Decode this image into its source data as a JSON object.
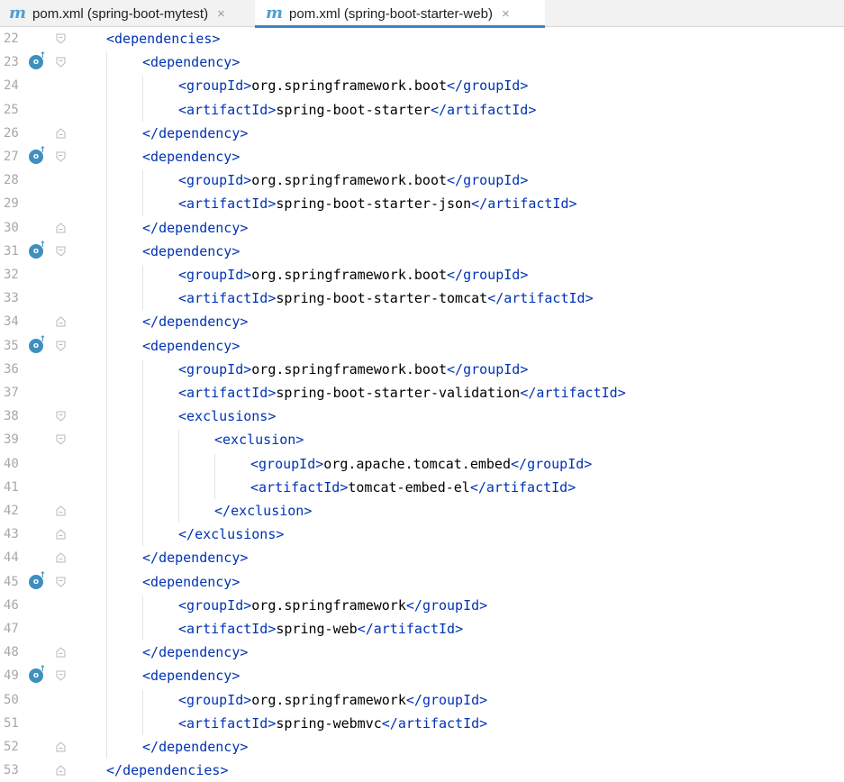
{
  "tabs": [
    {
      "icon": "m",
      "label": "pom.xml (spring-boot-mytest)",
      "close": "×",
      "active": false
    },
    {
      "icon": "m",
      "label": "pom.xml (spring-boot-starter-web)",
      "close": "×",
      "active": true
    }
  ],
  "colors": {
    "tag": "#0033b3",
    "text": "#000000",
    "line_number": "#a8a8a8",
    "accent": "#4083c9",
    "gutter_icon": "#3f8fbf"
  },
  "lines": [
    {
      "n": "22",
      "indent": 1,
      "open": "<",
      "tag": "dependencies",
      "close": ">",
      "text": "",
      "etag": "",
      "marker": "fold-open",
      "gicon": false
    },
    {
      "n": "23",
      "indent": 2,
      "open": "<",
      "tag": "dependency",
      "close": ">",
      "text": "",
      "etag": "",
      "marker": "fold-open",
      "gicon": true
    },
    {
      "n": "24",
      "indent": 3,
      "open": "<",
      "tag": "groupId",
      "close": ">",
      "text": "org.springframework.boot",
      "etag": "groupId",
      "marker": "",
      "gicon": false
    },
    {
      "n": "25",
      "indent": 3,
      "open": "<",
      "tag": "artifactId",
      "close": ">",
      "text": "spring-boot-starter",
      "etag": "artifactId",
      "marker": "",
      "gicon": false
    },
    {
      "n": "26",
      "indent": 2,
      "open": "</",
      "tag": "dependency",
      "close": ">",
      "text": "",
      "etag": "",
      "marker": "fold-close",
      "gicon": false
    },
    {
      "n": "27",
      "indent": 2,
      "open": "<",
      "tag": "dependency",
      "close": ">",
      "text": "",
      "etag": "",
      "marker": "fold-open",
      "gicon": true
    },
    {
      "n": "28",
      "indent": 3,
      "open": "<",
      "tag": "groupId",
      "close": ">",
      "text": "org.springframework.boot",
      "etag": "groupId",
      "marker": "",
      "gicon": false
    },
    {
      "n": "29",
      "indent": 3,
      "open": "<",
      "tag": "artifactId",
      "close": ">",
      "text": "spring-boot-starter-json",
      "etag": "artifactId",
      "marker": "",
      "gicon": false
    },
    {
      "n": "30",
      "indent": 2,
      "open": "</",
      "tag": "dependency",
      "close": ">",
      "text": "",
      "etag": "",
      "marker": "fold-close",
      "gicon": false
    },
    {
      "n": "31",
      "indent": 2,
      "open": "<",
      "tag": "dependency",
      "close": ">",
      "text": "",
      "etag": "",
      "marker": "fold-open",
      "gicon": true
    },
    {
      "n": "32",
      "indent": 3,
      "open": "<",
      "tag": "groupId",
      "close": ">",
      "text": "org.springframework.boot",
      "etag": "groupId",
      "marker": "",
      "gicon": false
    },
    {
      "n": "33",
      "indent": 3,
      "open": "<",
      "tag": "artifactId",
      "close": ">",
      "text": "spring-boot-starter-tomcat",
      "etag": "artifactId",
      "marker": "",
      "gicon": false
    },
    {
      "n": "34",
      "indent": 2,
      "open": "</",
      "tag": "dependency",
      "close": ">",
      "text": "",
      "etag": "",
      "marker": "fold-close",
      "gicon": false
    },
    {
      "n": "35",
      "indent": 2,
      "open": "<",
      "tag": "dependency",
      "close": ">",
      "text": "",
      "etag": "",
      "marker": "fold-open",
      "gicon": true
    },
    {
      "n": "36",
      "indent": 3,
      "open": "<",
      "tag": "groupId",
      "close": ">",
      "text": "org.springframework.boot",
      "etag": "groupId",
      "marker": "",
      "gicon": false
    },
    {
      "n": "37",
      "indent": 3,
      "open": "<",
      "tag": "artifactId",
      "close": ">",
      "text": "spring-boot-starter-validation",
      "etag": "artifactId",
      "marker": "",
      "gicon": false
    },
    {
      "n": "38",
      "indent": 3,
      "open": "<",
      "tag": "exclusions",
      "close": ">",
      "text": "",
      "etag": "",
      "marker": "fold-open",
      "gicon": false
    },
    {
      "n": "39",
      "indent": 4,
      "open": "<",
      "tag": "exclusion",
      "close": ">",
      "text": "",
      "etag": "",
      "marker": "fold-open",
      "gicon": false
    },
    {
      "n": "40",
      "indent": 5,
      "open": "<",
      "tag": "groupId",
      "close": ">",
      "text": "org.apache.tomcat.embed",
      "etag": "groupId",
      "marker": "",
      "gicon": false
    },
    {
      "n": "41",
      "indent": 5,
      "open": "<",
      "tag": "artifactId",
      "close": ">",
      "text": "tomcat-embed-el",
      "etag": "artifactId",
      "marker": "",
      "gicon": false
    },
    {
      "n": "42",
      "indent": 4,
      "open": "</",
      "tag": "exclusion",
      "close": ">",
      "text": "",
      "etag": "",
      "marker": "fold-close",
      "gicon": false
    },
    {
      "n": "43",
      "indent": 3,
      "open": "</",
      "tag": "exclusions",
      "close": ">",
      "text": "",
      "etag": "",
      "marker": "fold-close",
      "gicon": false
    },
    {
      "n": "44",
      "indent": 2,
      "open": "</",
      "tag": "dependency",
      "close": ">",
      "text": "",
      "etag": "",
      "marker": "fold-close",
      "gicon": false
    },
    {
      "n": "45",
      "indent": 2,
      "open": "<",
      "tag": "dependency",
      "close": ">",
      "text": "",
      "etag": "",
      "marker": "fold-open",
      "gicon": true
    },
    {
      "n": "46",
      "indent": 3,
      "open": "<",
      "tag": "groupId",
      "close": ">",
      "text": "org.springframework",
      "etag": "groupId",
      "marker": "",
      "gicon": false
    },
    {
      "n": "47",
      "indent": 3,
      "open": "<",
      "tag": "artifactId",
      "close": ">",
      "text": "spring-web",
      "etag": "artifactId",
      "marker": "",
      "gicon": false
    },
    {
      "n": "48",
      "indent": 2,
      "open": "</",
      "tag": "dependency",
      "close": ">",
      "text": "",
      "etag": "",
      "marker": "fold-close",
      "gicon": false
    },
    {
      "n": "49",
      "indent": 2,
      "open": "<",
      "tag": "dependency",
      "close": ">",
      "text": "",
      "etag": "",
      "marker": "fold-open",
      "gicon": true
    },
    {
      "n": "50",
      "indent": 3,
      "open": "<",
      "tag": "groupId",
      "close": ">",
      "text": "org.springframework",
      "etag": "groupId",
      "marker": "",
      "gicon": false
    },
    {
      "n": "51",
      "indent": 3,
      "open": "<",
      "tag": "artifactId",
      "close": ">",
      "text": "spring-webmvc",
      "etag": "artifactId",
      "marker": "",
      "gicon": false
    },
    {
      "n": "52",
      "indent": 2,
      "open": "</",
      "tag": "dependency",
      "close": ">",
      "text": "",
      "etag": "",
      "marker": "fold-close",
      "gicon": false
    },
    {
      "n": "53",
      "indent": 1,
      "open": "</",
      "tag": "dependencies",
      "close": ">",
      "text": "",
      "etag": "",
      "marker": "fold-close",
      "gicon": false
    }
  ]
}
